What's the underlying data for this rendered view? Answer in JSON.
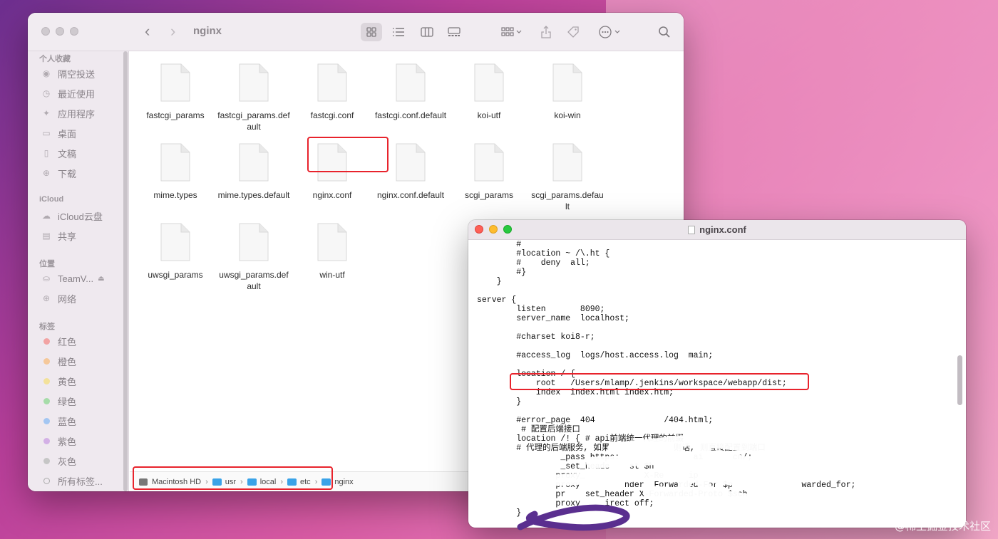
{
  "finder": {
    "title": "nginx",
    "nav": {
      "back": "‹",
      "forward": "›"
    },
    "toolbar_icons": [
      "grid-view-icon",
      "list-view-icon",
      "column-view-icon",
      "gallery-view-icon",
      "group-icon",
      "share-icon",
      "tag-icon",
      "more-icon",
      "search-icon"
    ],
    "sidebar": {
      "favorites_header": "个人收藏",
      "favorites": [
        {
          "label": "隔空投送",
          "icon": "airdrop-icon",
          "glyph": "◉"
        },
        {
          "label": "最近使用",
          "icon": "clock-icon",
          "glyph": "◷"
        },
        {
          "label": "应用程序",
          "icon": "applications-icon",
          "glyph": "✦"
        },
        {
          "label": "桌面",
          "icon": "desktop-icon",
          "glyph": "▭"
        },
        {
          "label": "文稿",
          "icon": "document-icon",
          "glyph": "▯"
        },
        {
          "label": "下载",
          "icon": "download-icon",
          "glyph": "⊕"
        }
      ],
      "icloud_header": "iCloud",
      "icloud": [
        {
          "label": "iCloud云盘",
          "icon": "cloud-icon",
          "glyph": "☁"
        },
        {
          "label": "共享",
          "icon": "shared-folder-icon",
          "glyph": "▤"
        }
      ],
      "locations_header": "位置",
      "locations": [
        {
          "label": "TeamV...",
          "icon": "drive-icon",
          "glyph": "⛀",
          "eject": "⏏"
        },
        {
          "label": "网络",
          "icon": "network-icon",
          "glyph": "⊕"
        }
      ],
      "tags_header": "标签",
      "tags": [
        {
          "label": "红色",
          "color": "#f2a3a3"
        },
        {
          "label": "橙色",
          "color": "#f5c89a"
        },
        {
          "label": "黄色",
          "color": "#f3e19a"
        },
        {
          "label": "绿色",
          "color": "#a6dca9"
        },
        {
          "label": "蓝色",
          "color": "#a3c6f2"
        },
        {
          "label": "紫色",
          "color": "#d3b0e6"
        },
        {
          "label": "灰色",
          "color": "#c6c6c6"
        },
        {
          "label": "所有标签...",
          "color": ""
        }
      ]
    },
    "files": [
      "fastcgi_params",
      "fastcgi_params.default",
      "fastcgi.conf",
      "fastcgi.conf.default",
      "koi-utf",
      "koi-win",
      "mime.types",
      "mime.types.default",
      "nginx.conf",
      "nginx.conf.default",
      "scgi_params",
      "scgi_params.default",
      "uwsgi_params",
      "uwsgi_params.default",
      "win-utf"
    ],
    "path": [
      "Macintosh HD",
      "usr",
      "local",
      "etc",
      "nginx"
    ],
    "path_separator": "›"
  },
  "editor": {
    "title": "nginx.conf",
    "lines": [
      "        #",
      "        #location ~ /\\.ht {",
      "        #    deny  all;",
      "        #}",
      "    }",
      "",
      "server {",
      "        listen       8090;",
      "        server_name  localhost;",
      "",
      "        #charset koi8-r;",
      "",
      "        #access_log  logs/host.access.log  main;",
      "",
      "        location / {",
      "            root   /Users/mlamp/.jenkins/workspace/webapp/dist;",
      "            index  index.html index.htm;",
      "        }",
      "",
      "        #error_page  404              /404.html;",
      "         # 配置后端接口",
      "        location /! { # api前端统一代理的前缀",
      "        # 代理的后端服务, 如果             则话, 则直接配置到端口",
      "                 _pass https:               ai      cn/;",
      "                 _set_heade    st $h",
      "                proxy_            X-Re     ip",
      "                proxy         nder  Forwarded-For $p              warded_for;",
      "                pr    set_header X-Forwarded-Proto $sch",
      "                proxy     irect off;",
      "        }"
    ]
  },
  "watermark": "@稀土掘金技术社区",
  "colors": {
    "highlight": "#e8232c",
    "folder": "#3aa3e8"
  }
}
